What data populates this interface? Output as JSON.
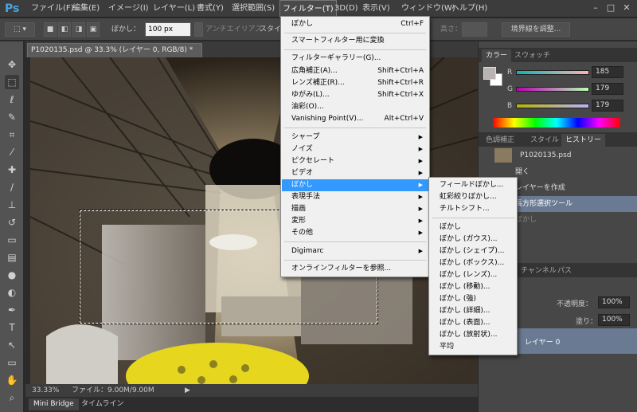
{
  "app": {
    "logo": "Ps",
    "min": "–",
    "restore": "□",
    "close": "✕"
  },
  "menus": [
    "ファイル(F)",
    "編集(E)",
    "イメージ(I)",
    "レイヤー(L)",
    "書式(Y)",
    "選択範囲(S)",
    "フィルター(T)",
    "3D(D)",
    "表示(V)",
    "ウィンドウ(W)",
    "ヘルプ(H)"
  ],
  "options": {
    "feather_label": "ぼかし：",
    "feather_value": "100 px",
    "antialias_label": "アンチエイリアス",
    "style_label": "スタイ",
    "height_label": "高さ：",
    "refine_button": "境界線を調整..."
  },
  "document": {
    "tab_title": "P1020135.psd @ 33.3% (レイヤー 0, RGB/8) *",
    "zoom": "33.33%",
    "file_info": "ファイル：9.00M/9.00M"
  },
  "bottom_tabs": [
    "Mini Bridge",
    "タイムライン"
  ],
  "filter_menu": {
    "last_filter": "ぼかし",
    "last_filter_shortcut": "Ctrl+F",
    "smart": "スマートフィルター用に変換",
    "gallery": "フィルターギャラリー(G)...",
    "wide": "広角補正(A)...",
    "wide_sc": "Shift+Ctrl+A",
    "lens": "レンズ補正(R)...",
    "lens_sc": "Shift+Ctrl+R",
    "liquify": "ゆがみ(L)...",
    "liquify_sc": "Shift+Ctrl+X",
    "oil": "油彩(O)...",
    "vanishing": "Vanishing Point(V)...",
    "vanishing_sc": "Alt+Ctrl+V",
    "sub": [
      "シャープ",
      "ノイズ",
      "ピクセレート",
      "ビデオ",
      "ぼかし",
      "表現手法",
      "描画",
      "変形",
      "その他"
    ],
    "digimarc": "Digimarc",
    "online": "オンラインフィルターを参照..."
  },
  "blur_menu": {
    "top": [
      "フィールドぼかし...",
      "虹彩絞りぼかし...",
      "チルトシフト..."
    ],
    "items": [
      "ぼかし",
      "ぼかし (ガウス)...",
      "ぼかし (シェイプ)...",
      "ぼかし (ボックス)...",
      "ぼかし (レンズ)...",
      "ぼかし (移動)...",
      "ぼかし (強)",
      "ぼかし (詳細)...",
      "ぼかし (表面)...",
      "ぼかし (放射状)...",
      "平均"
    ]
  },
  "color_panel": {
    "tabs": [
      "カラー",
      "スウォッチ"
    ],
    "r": "185",
    "g": "179",
    "b": "179",
    "r_label": "R",
    "g_label": "G",
    "b_label": "B",
    "fg": "#b9b3b3"
  },
  "history_panel": {
    "tabs": [
      "色調補正",
      "スタイル",
      "ヒストリー"
    ],
    "snapshot": "P1020135.psd",
    "items": [
      "開く",
      "レイヤーを作成",
      "長方形選択ツール",
      "ぼかし"
    ]
  },
  "layers_panel": {
    "tabs": [
      "チャンネル",
      "パス"
    ],
    "opacity_label": "不透明度：",
    "opacity": "100%",
    "fill_label": "塗り：",
    "fill": "100%",
    "layer_name": "レイヤー 0"
  }
}
